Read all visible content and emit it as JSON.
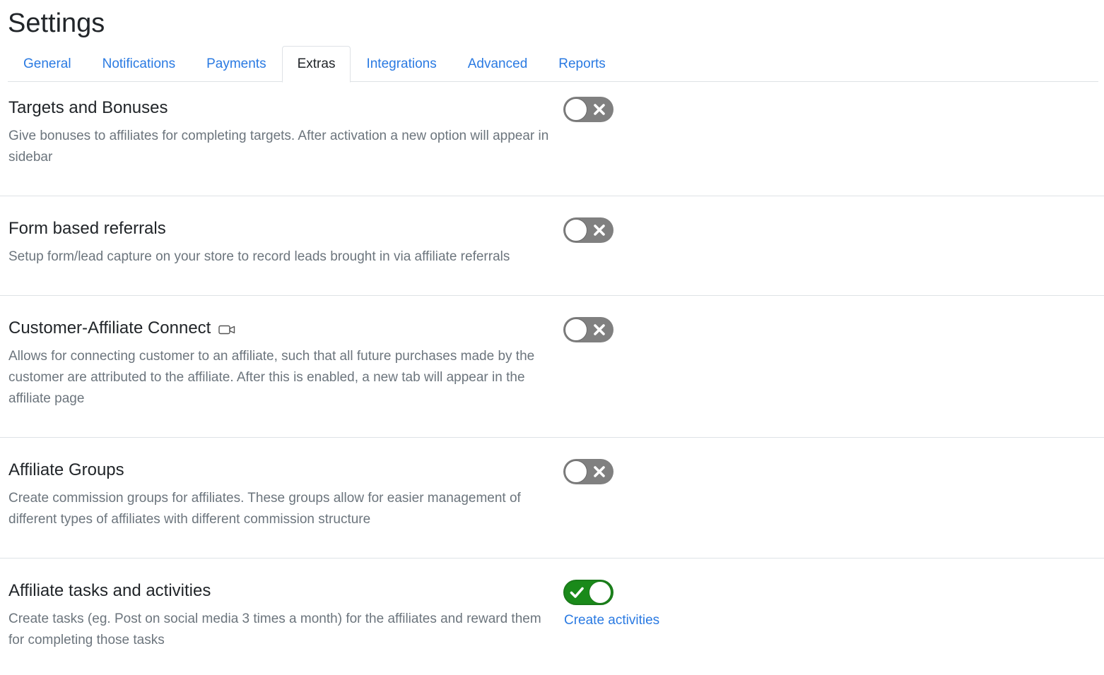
{
  "page": {
    "title": "Settings"
  },
  "tabs": [
    {
      "label": "General"
    },
    {
      "label": "Notifications"
    },
    {
      "label": "Payments"
    },
    {
      "label": "Extras"
    },
    {
      "label": "Integrations"
    },
    {
      "label": "Advanced"
    },
    {
      "label": "Reports"
    }
  ],
  "active_tab": "Extras",
  "settings": [
    {
      "title": "Targets and Bonuses",
      "description": "Give bonuses to affiliates for completing targets. After activation a new option will appear in sidebar",
      "enabled": false
    },
    {
      "title": "Form based referrals",
      "description": "Setup form/lead capture on your store to record leads brought in via affiliate referrals",
      "enabled": false
    },
    {
      "title": "Customer-Affiliate Connect",
      "description": "Allows for connecting customer to an affiliate, such that all future purchases made by the customer are attributed to the affiliate. After this is enabled, a new tab will appear in the affiliate page",
      "enabled": false,
      "icon": "video-camera-icon"
    },
    {
      "title": "Affiliate Groups",
      "description": "Create commission groups for affiliates. These groups allow for easier management of different types of affiliates with different commission structure",
      "enabled": false
    },
    {
      "title": "Affiliate tasks and activities",
      "description": "Create tasks (eg. Post on social media 3 times a month) for the affiliates and reward them for completing those tasks",
      "enabled": true,
      "link_label": "Create activities"
    }
  ],
  "colors": {
    "link": "#2a7ae2",
    "toggle_off": "#808080",
    "toggle_on": "#1a8a1a",
    "muted_text": "#6c757d"
  }
}
